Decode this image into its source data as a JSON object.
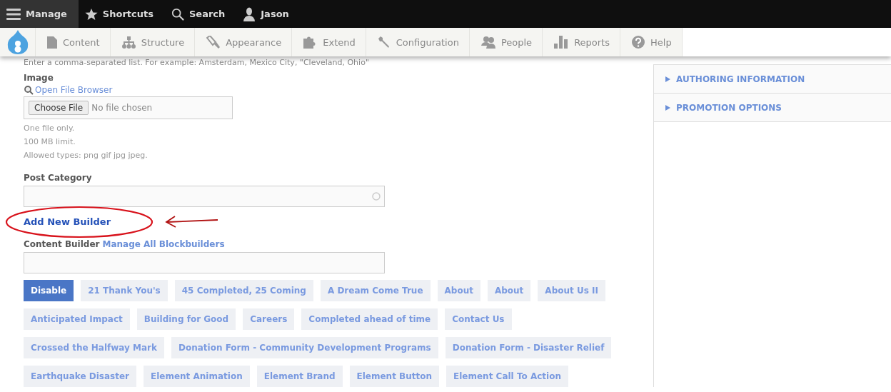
{
  "toolbar": {
    "items": [
      {
        "kind": "menu",
        "label": "Manage",
        "selected": true
      },
      {
        "kind": "star",
        "label": "Shortcuts",
        "selected": false
      },
      {
        "kind": "search",
        "label": "Search",
        "selected": false
      },
      {
        "kind": "user",
        "label": "Jason",
        "selected": false
      }
    ]
  },
  "tray": {
    "items": [
      {
        "kind": "file",
        "label": "Content"
      },
      {
        "kind": "structure",
        "label": "Structure"
      },
      {
        "kind": "brush",
        "label": "Appearance"
      },
      {
        "kind": "puzzle",
        "label": "Extend"
      },
      {
        "kind": "wrench",
        "label": "Configuration"
      },
      {
        "kind": "people",
        "label": "People"
      },
      {
        "kind": "bars",
        "label": "Reports"
      },
      {
        "kind": "help",
        "label": "Help"
      }
    ]
  },
  "form": {
    "tags_hint": "Enter a comma-separated list. For example: Amsterdam, Mexico City, \"Cleveland, Ohio\"",
    "image": {
      "label": "Image",
      "browser_link": "Open File Browser",
      "choose_button": "Choose File",
      "file_status": "No file chosen",
      "notes": [
        "One file only.",
        "100 MB limit.",
        "Allowed types: png gif jpg jpeg."
      ]
    },
    "post_category": {
      "label": "Post Category"
    },
    "add_builder_link": "Add New Builder",
    "content_builder": {
      "label": "Content Builder",
      "manage_link": "Manage All Blockbuilders"
    },
    "block_rows": [
      [
        {
          "kind": "action",
          "label": "Disable"
        },
        {
          "kind": "block",
          "label": "21 Thank You's"
        },
        {
          "kind": "block",
          "label": "45 Completed, 25 Coming"
        },
        {
          "kind": "block",
          "label": "A Dream Come True"
        },
        {
          "kind": "block",
          "label": "About"
        },
        {
          "kind": "block",
          "label": "About"
        },
        {
          "kind": "block",
          "label": "About Us II"
        }
      ],
      [
        {
          "kind": "block",
          "label": "Anticipated Impact"
        },
        {
          "kind": "block",
          "label": "Building for Good"
        },
        {
          "kind": "block",
          "label": "Careers"
        },
        {
          "kind": "block",
          "label": "Completed ahead of time"
        },
        {
          "kind": "block",
          "label": "Contact Us"
        }
      ],
      [
        {
          "kind": "block",
          "label": "Crossed the Halfway Mark"
        },
        {
          "kind": "block",
          "label": "Donation Form - Community Development Programs"
        },
        {
          "kind": "block",
          "label": "Donation Form - Disaster Relief"
        }
      ],
      [
        {
          "kind": "block",
          "label": "Earthquake Disaster"
        },
        {
          "kind": "block",
          "label": "Element Animation"
        },
        {
          "kind": "block",
          "label": "Element Brand"
        },
        {
          "kind": "block",
          "label": "Element Button"
        },
        {
          "kind": "block",
          "label": "Element Call To Action"
        }
      ]
    ]
  },
  "sidebar": {
    "sections": [
      {
        "label": "AUTHORING INFORMATION",
        "expanded": false
      },
      {
        "label": "PROMOTION OPTIONS",
        "expanded": false
      }
    ]
  }
}
